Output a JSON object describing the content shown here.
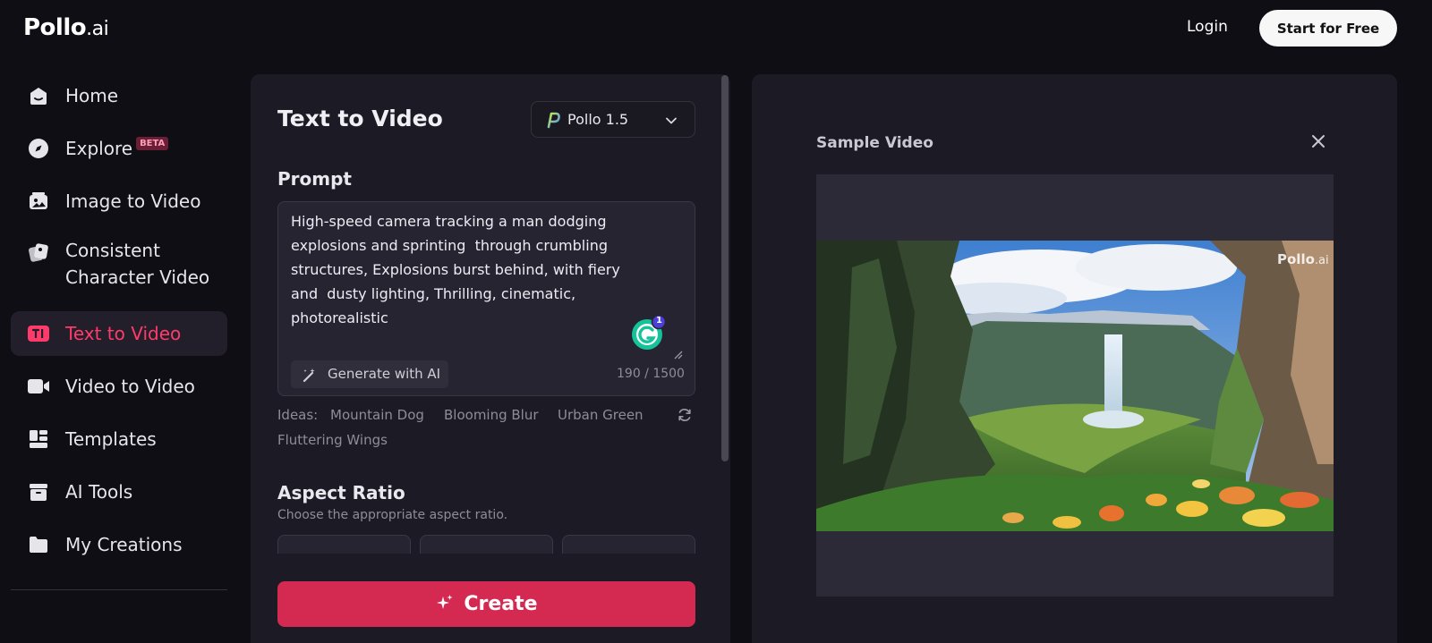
{
  "header": {
    "logo_main": "Pollo",
    "logo_suffix": ".ai",
    "login_label": "Login",
    "start_label": "Start for Free"
  },
  "sidebar": {
    "items": [
      {
        "label": "Home",
        "icon": "home-icon"
      },
      {
        "label": "Explore",
        "icon": "compass-icon",
        "badge": "BETA"
      },
      {
        "label": "Image to Video",
        "icon": "image-video-icon"
      },
      {
        "label": "Consistent\nCharacter Video",
        "icon": "character-icon"
      },
      {
        "label": "Text to Video",
        "icon": "text-video-icon",
        "active": true
      },
      {
        "label": "Video to Video",
        "icon": "video-camera-icon"
      },
      {
        "label": "Templates",
        "icon": "templates-icon"
      },
      {
        "label": "AI Tools",
        "icon": "toolbox-icon"
      },
      {
        "label": "My Creations",
        "icon": "folder-icon"
      }
    ]
  },
  "panel": {
    "title": "Text to Video",
    "model": "Pollo 1.5",
    "prompt_heading": "Prompt",
    "prompt_text": "High-speed camera tracking a man dodging\nexplosions and sprinting  through crumbling\nstructures, Explosions burst behind, with fiery\nand  dusty lighting, Thrilling, cinematic,\nphotorealistic",
    "grammarly_count": "1",
    "generate_label": "Generate with AI",
    "char_count": "190 / 1500",
    "ideas_label": "Ideas:",
    "ideas": [
      "Mountain Dog",
      "Blooming Blur",
      "Urban Green",
      "Fluttering Wings"
    ],
    "aspect_heading": "Aspect Ratio",
    "aspect_sub": "Choose the appropriate aspect ratio.",
    "create_label": "Create"
  },
  "preview": {
    "title": "Sample Video",
    "watermark_main": "Pollo",
    "watermark_suffix": ".ai"
  },
  "colors": {
    "accent": "#d42a52",
    "active_text": "#ff3b6b",
    "background": "#0f0e14",
    "panel": "#1c1b25"
  }
}
